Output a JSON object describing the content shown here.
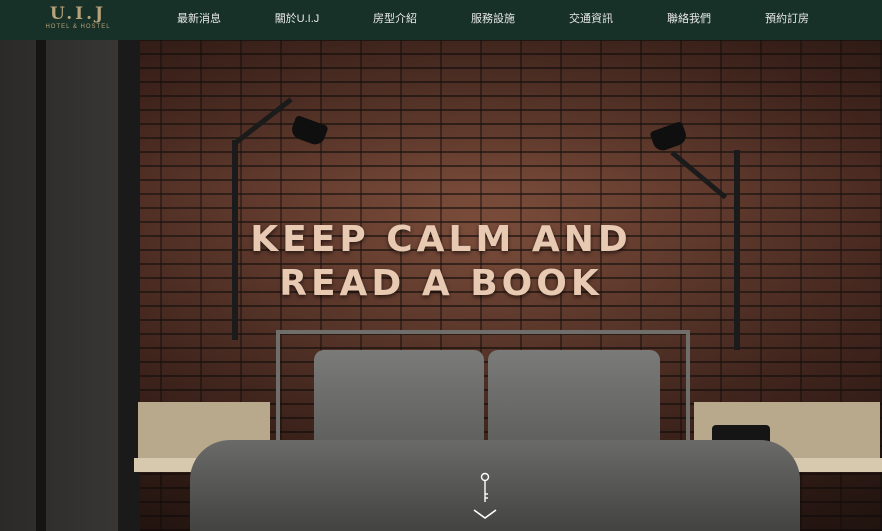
{
  "brand": {
    "name": "U.I.J",
    "tagline": "HOTEL & HOSTEL",
    "color": "#b7a37a"
  },
  "nav": {
    "background": "#173028",
    "items": [
      {
        "label": "最新消息"
      },
      {
        "label": "關於U.I.J"
      },
      {
        "label": "房型介紹"
      },
      {
        "label": "服務設施"
      },
      {
        "label": "交通資訊"
      },
      {
        "label": "聯絡我們"
      },
      {
        "label": "預約訂房"
      }
    ]
  },
  "hero": {
    "headline_line1": "KEEP CALM AND",
    "headline_line2": "READ A BOOK",
    "scroll_icon": "key-arrow-down-icon"
  }
}
